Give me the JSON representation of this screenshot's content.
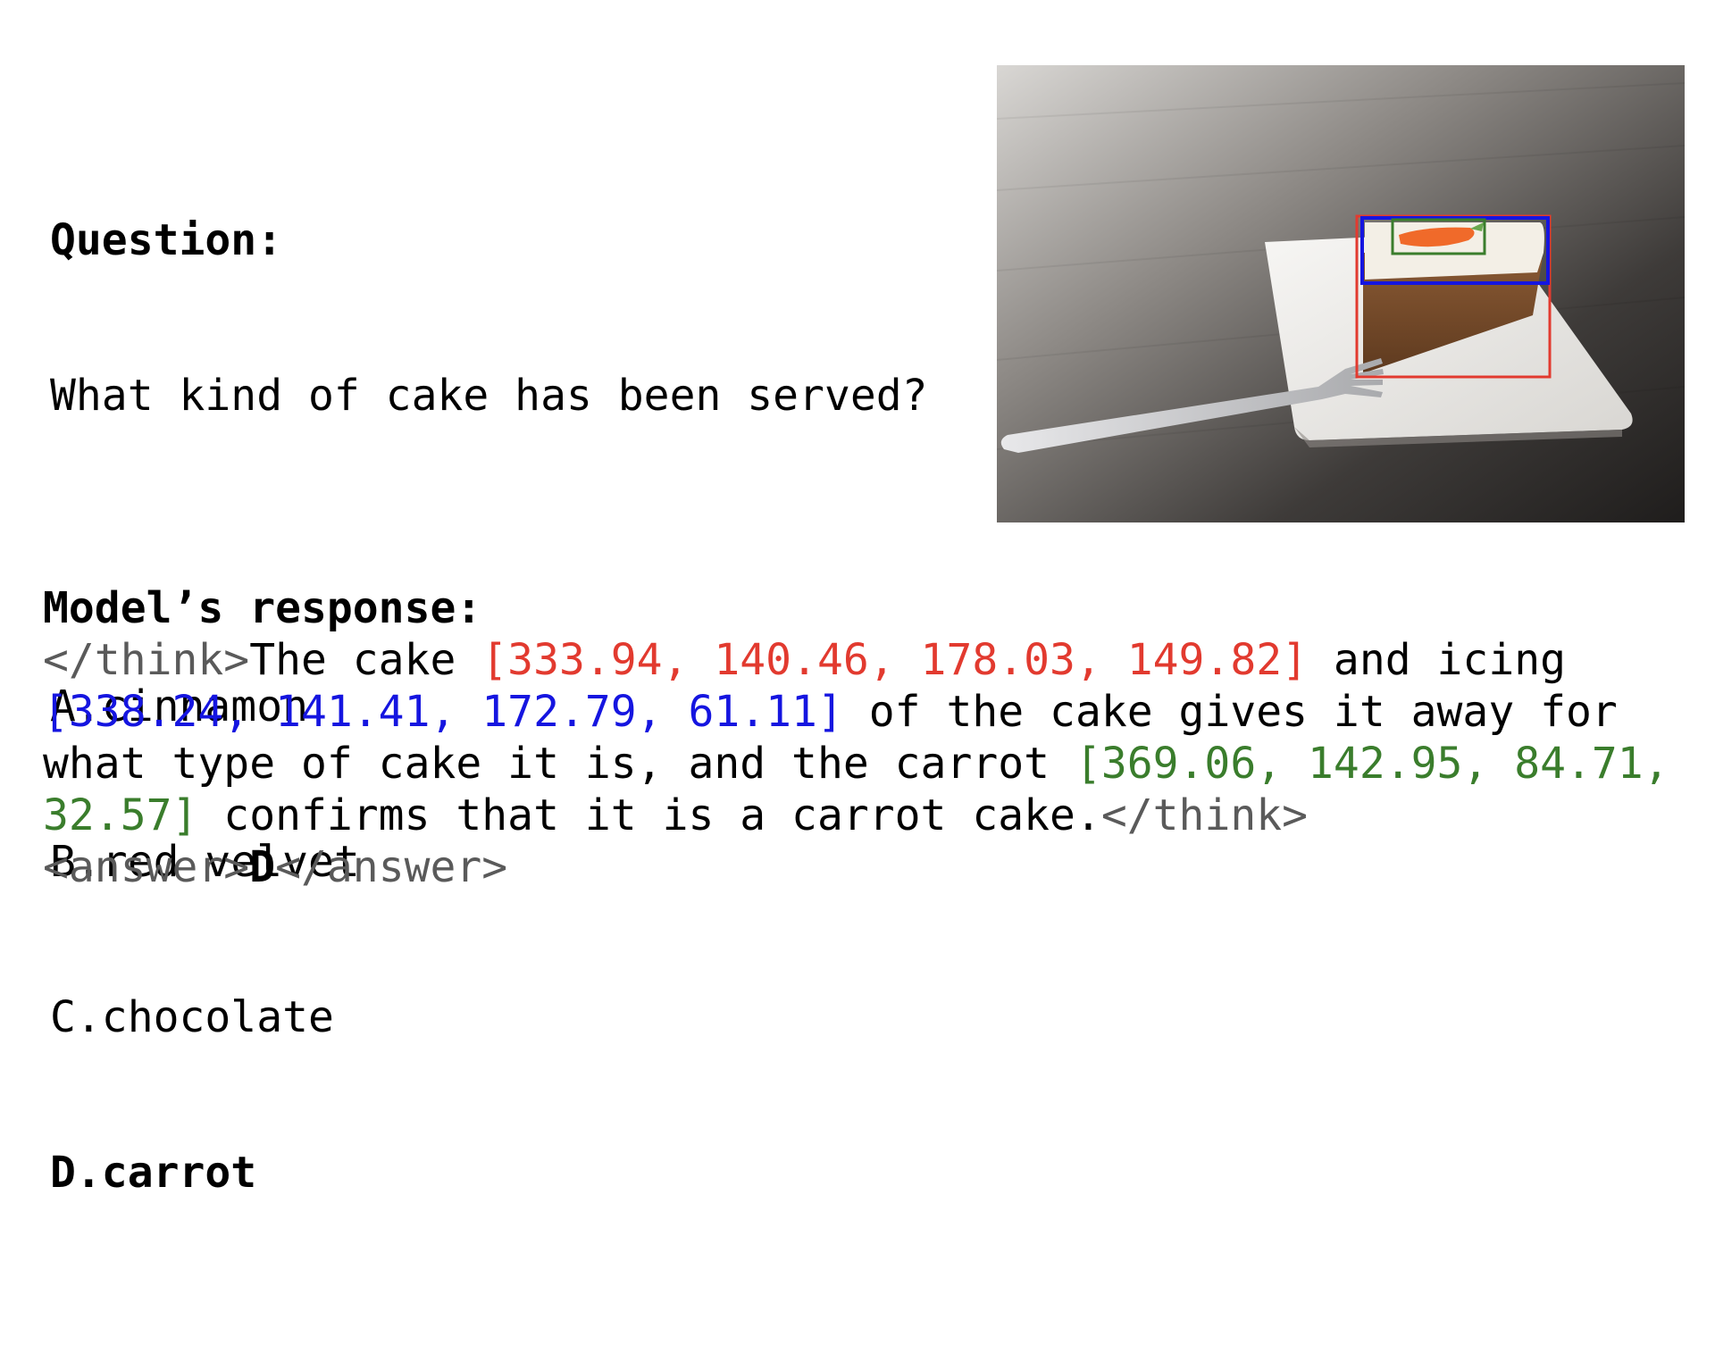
{
  "question": {
    "label": "Question:",
    "text": "What kind of cake has been served?",
    "options": [
      {
        "letter": "A.",
        "text": "cinnamon"
      },
      {
        "letter": "B.",
        "text": "red velvet"
      },
      {
        "letter": "C.",
        "text": "chocolate"
      },
      {
        "letter": "D.",
        "text": "carrot"
      }
    ],
    "correct_option": "D"
  },
  "photo": {
    "description_icon": "cake-photo",
    "boxes": [
      {
        "name": "cake",
        "color": "#e23a2f"
      },
      {
        "name": "icing",
        "color": "#1515e0"
      },
      {
        "name": "carrot",
        "color": "#3a7d2c"
      }
    ]
  },
  "response": {
    "label": "Model’s response:",
    "think_open": "</think>",
    "seg1": "The cake ",
    "box_cake": "[333.94, 140.46, 178.03, 149.82]",
    "seg2": " and icing ",
    "box_icing": "[338.24, 141.41, 172.79, 61.11]",
    "seg3": " of the cake gives it away for what type of cake it is, and the carrot ",
    "box_carrot": "[369.06, 142.95, 84.71, 32.57]",
    "seg4": " confirms that it is a carrot cake.",
    "think_close": "</think>",
    "answer_open": "<answer>",
    "answer_value": "D",
    "answer_close": "</answer>"
  },
  "colors": {
    "cake_box": "#e23a2f",
    "icing_box": "#1515e0",
    "carrot_box": "#3a7d2c",
    "tag_text": "#5a5a5a"
  }
}
